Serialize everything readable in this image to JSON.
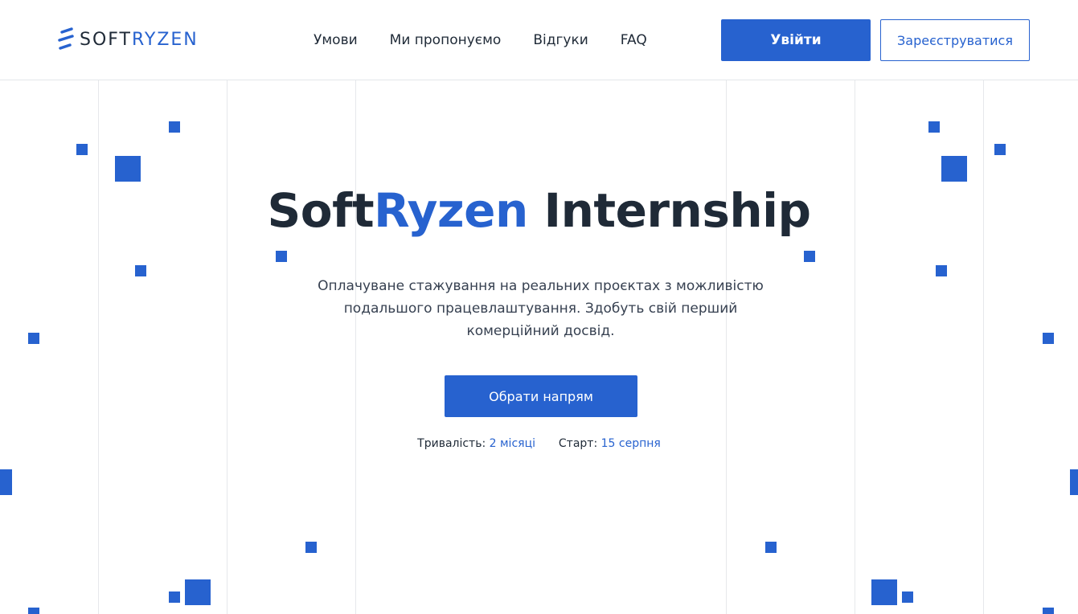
{
  "brand": {
    "logo_text_main": "SOFT",
    "logo_text_accent": "RYZEN",
    "accent_color": "#2762cf",
    "text_color": "#1f2a37"
  },
  "nav": {
    "items": [
      {
        "label": "Умови"
      },
      {
        "label": "Ми пропонуємо"
      },
      {
        "label": "Відгуки"
      },
      {
        "label": "FAQ"
      }
    ]
  },
  "header": {
    "login_label": "Увійти",
    "register_label": "Зареєструватися"
  },
  "hero": {
    "title_part1": "Soft",
    "title_accent": "Ryzen",
    "title_part2": " Internship",
    "subtitle": "Оплачуване стажування на реальних проєктах з можливістю подальшого працевлаштування. Здобуть свій перший комерційний досвід.",
    "cta_label": "Обрати напрям",
    "duration_label": "Тривалість:",
    "duration_value": "2 місяці",
    "start_label": "Старт:",
    "start_value": "15 серпня"
  }
}
